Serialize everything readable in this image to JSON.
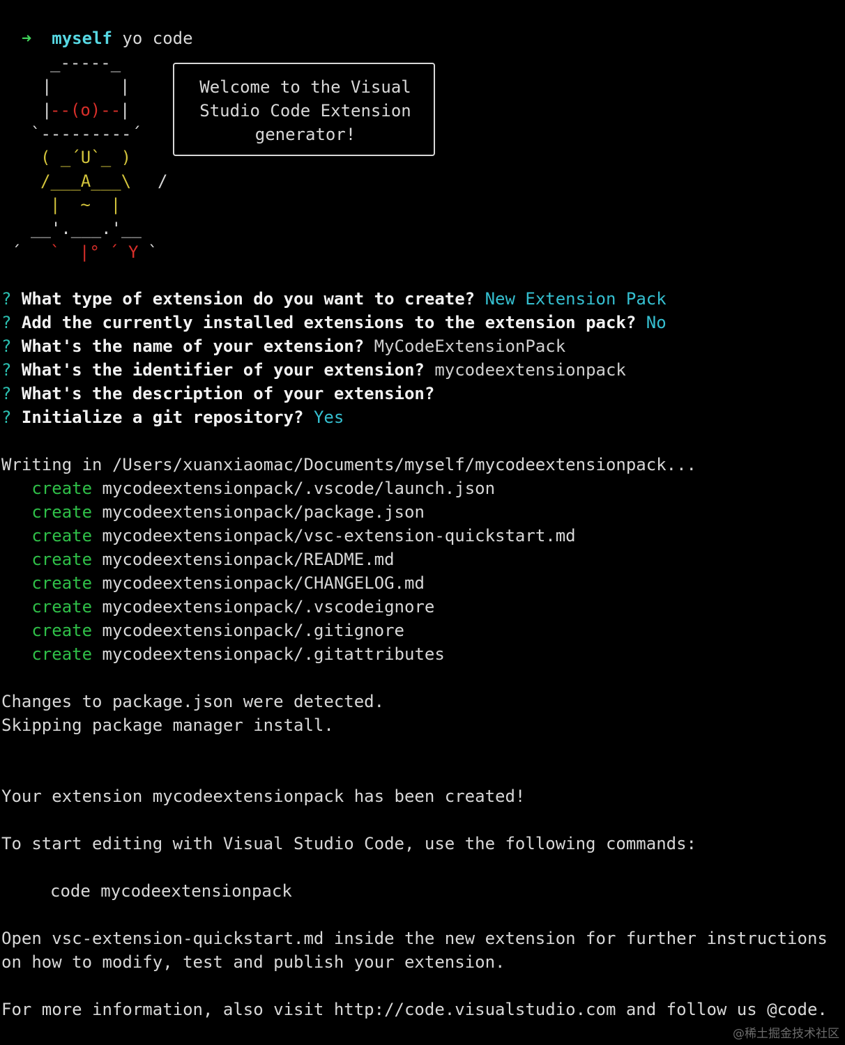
{
  "prompt": {
    "arrow": "➜",
    "dir": "myself",
    "command": "yo code"
  },
  "ascii_art": {
    "row1": "_-----_",
    "row2a": "|",
    "row2b": "|",
    "row3a": "|",
    "row3b": "--(o)--",
    "row3c": "|",
    "row4": "`---------´",
    "row5": "( _´U`_ )",
    "row6": "/___A___\\",
    "row6b": "/",
    "row7": "|  ~  |",
    "row8": "__'.___.'__",
    "row9a": "´",
    "row9b": "`",
    "row9c": "|°",
    "row9d": "´",
    "row9e": "Y",
    "row9f": "`"
  },
  "welcome": {
    "line1": "Welcome to the Visual",
    "line2": "Studio Code Extension",
    "line3": "generator!"
  },
  "questions": [
    {
      "mark": "?",
      "text": "What type of extension do you want to create?",
      "answer": "New Extension Pack"
    },
    {
      "mark": "?",
      "text": "Add the currently installed extensions to the extension pack?",
      "answer": "No"
    },
    {
      "mark": "?",
      "text": "What's the name of your extension?",
      "answer": "MyCodeExtensionPack"
    },
    {
      "mark": "?",
      "text": "What's the identifier of your extension?",
      "answer": "mycodeextensionpack"
    },
    {
      "mark": "?",
      "text": "What's the description of your extension?",
      "answer": ""
    },
    {
      "mark": "?",
      "text": "Initialize a git repository?",
      "answer": "Yes"
    }
  ],
  "writing": "Writing in /Users/xuanxiaomac/Documents/myself/mycodeextensionpack...",
  "creates": [
    {
      "label": "create",
      "path": "mycodeextensionpack/.vscode/launch.json"
    },
    {
      "label": "create",
      "path": "mycodeextensionpack/package.json"
    },
    {
      "label": "create",
      "path": "mycodeextensionpack/vsc-extension-quickstart.md"
    },
    {
      "label": "create",
      "path": "mycodeextensionpack/README.md"
    },
    {
      "label": "create",
      "path": "mycodeextensionpack/CHANGELOG.md"
    },
    {
      "label": "create",
      "path": "mycodeextensionpack/.vscodeignore"
    },
    {
      "label": "create",
      "path": "mycodeextensionpack/.gitignore"
    },
    {
      "label": "create",
      "path": "mycodeextensionpack/.gitattributes"
    }
  ],
  "messages": {
    "changes": "Changes to package.json were detected.",
    "skipping": "Skipping package manager install.",
    "created": "Your extension mycodeextensionpack has been created!",
    "start": "To start editing with Visual Studio Code, use the following commands:",
    "code_cmd": "code mycodeextensionpack",
    "open1": "Open vsc-extension-quickstart.md inside the new extension for further instructions",
    "open2": "on how to modify, test and publish your extension.",
    "more": "For more information, also visit http://code.visualstudio.com and follow us @code."
  },
  "watermark": "@稀土掘金技术社区",
  "colors": {
    "background": "#000000",
    "prompt_arrow": "#3fd15a",
    "prompt_dir": "#57d8e3",
    "question_mark": "#2bbfb0",
    "answer": "#35bfd0",
    "create": "#2fbf48",
    "art_red": "#d82f2a",
    "art_yellow": "#d4c53c"
  }
}
